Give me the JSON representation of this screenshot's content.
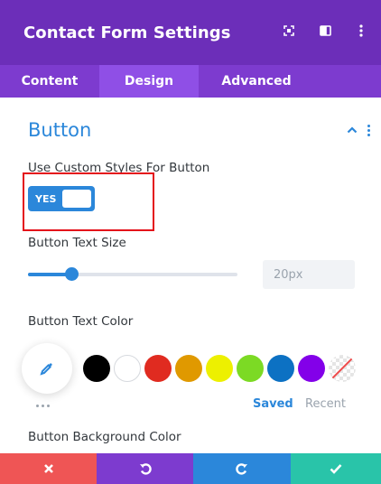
{
  "header": {
    "title": "Contact Form Settings",
    "icons": [
      "fullscreen-icon",
      "split-view-icon",
      "more-options-icon"
    ]
  },
  "tabs": [
    {
      "label": "Content",
      "active": false
    },
    {
      "label": "Design",
      "active": true
    },
    {
      "label": "Advanced",
      "active": false
    }
  ],
  "section": {
    "title": "Button",
    "icons": [
      "chevron-up-icon",
      "more-options-icon"
    ]
  },
  "custom_styles": {
    "label": "Use Custom Styles For Button",
    "toggle_text": "YES",
    "enabled": true
  },
  "text_size": {
    "label": "Button Text Size",
    "value": "20px",
    "slider_fraction": 0.21
  },
  "text_color": {
    "label": "Button Text Color",
    "swatches": [
      "#000000",
      "#ffffff",
      "#e02b20",
      "#e09900",
      "#edf000",
      "#7cda24",
      "#0c71c3",
      "#8300e9",
      "none"
    ],
    "saved_label": "Saved",
    "recent_label": "Recent",
    "picker_icon": "eyedropper-icon"
  },
  "background_color": {
    "label": "Button Background Color"
  },
  "bottom_bar": {
    "buttons": [
      {
        "name": "cancel",
        "icon": "close-icon",
        "color": "#ef5555"
      },
      {
        "name": "undo",
        "icon": "undo-icon",
        "color": "#7d3bcf"
      },
      {
        "name": "redo",
        "icon": "redo-icon",
        "color": "#2b87da"
      },
      {
        "name": "save",
        "icon": "check-icon",
        "color": "#29c4a9"
      }
    ]
  },
  "colors": {
    "header_bg": "#6c2eb9",
    "tabs_bg": "#7d3bcf",
    "active_tab_bg": "#8f4fe6",
    "accent": "#2b87da",
    "highlight_border": "#e4101a"
  }
}
